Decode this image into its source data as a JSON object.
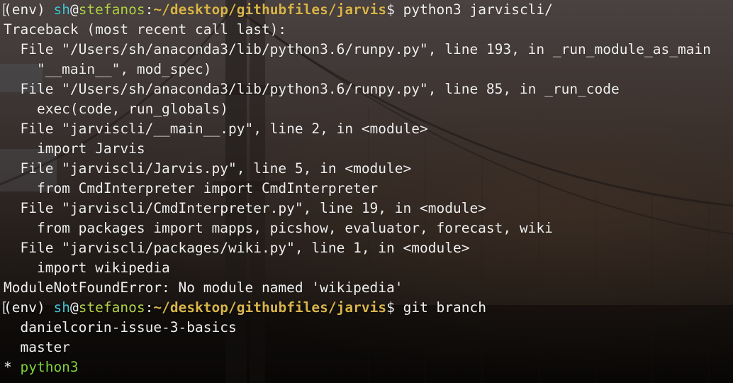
{
  "prompt_parts": {
    "env": "(env)",
    "user": "sh",
    "at": "@",
    "host": "stefanos",
    "colon": ":",
    "path": "~/desktop/githubfiles/jarvis",
    "dollar": "$"
  },
  "commands": {
    "first": " python3 jarviscli/",
    "second": " git branch"
  },
  "traceback": [
    "Traceback (most recent call last):",
    "  File \"/Users/sh/anaconda3/lib/python3.6/runpy.py\", line 193, in _run_module_as_main",
    "    \"__main__\", mod_spec)",
    "  File \"/Users/sh/anaconda3/lib/python3.6/runpy.py\", line 85, in _run_code",
    "    exec(code, run_globals)",
    "  File \"jarviscli/__main__.py\", line 2, in <module>",
    "    import Jarvis",
    "  File \"jarviscli/Jarvis.py\", line 5, in <module>",
    "    from CmdInterpreter import CmdInterpreter",
    "  File \"jarviscli/CmdInterpreter.py\", line 19, in <module>",
    "    from packages import mapps, picshow, evaluator, forecast, wiki",
    "  File \"jarviscli/packages/wiki.py\", line 1, in <module>",
    "    import wikipedia",
    "ModuleNotFoundError: No module named 'wikipedia'"
  ],
  "branches": {
    "first": "  danielcorin-issue-3-basics",
    "second": "  master",
    "current_marker": "* ",
    "current": "python3"
  },
  "colors": {
    "user": "#46c7d9",
    "host": "#b3d34a",
    "path": "#d9b54a",
    "current_branch": "#7fd13b",
    "text": "#f0f0f0"
  }
}
